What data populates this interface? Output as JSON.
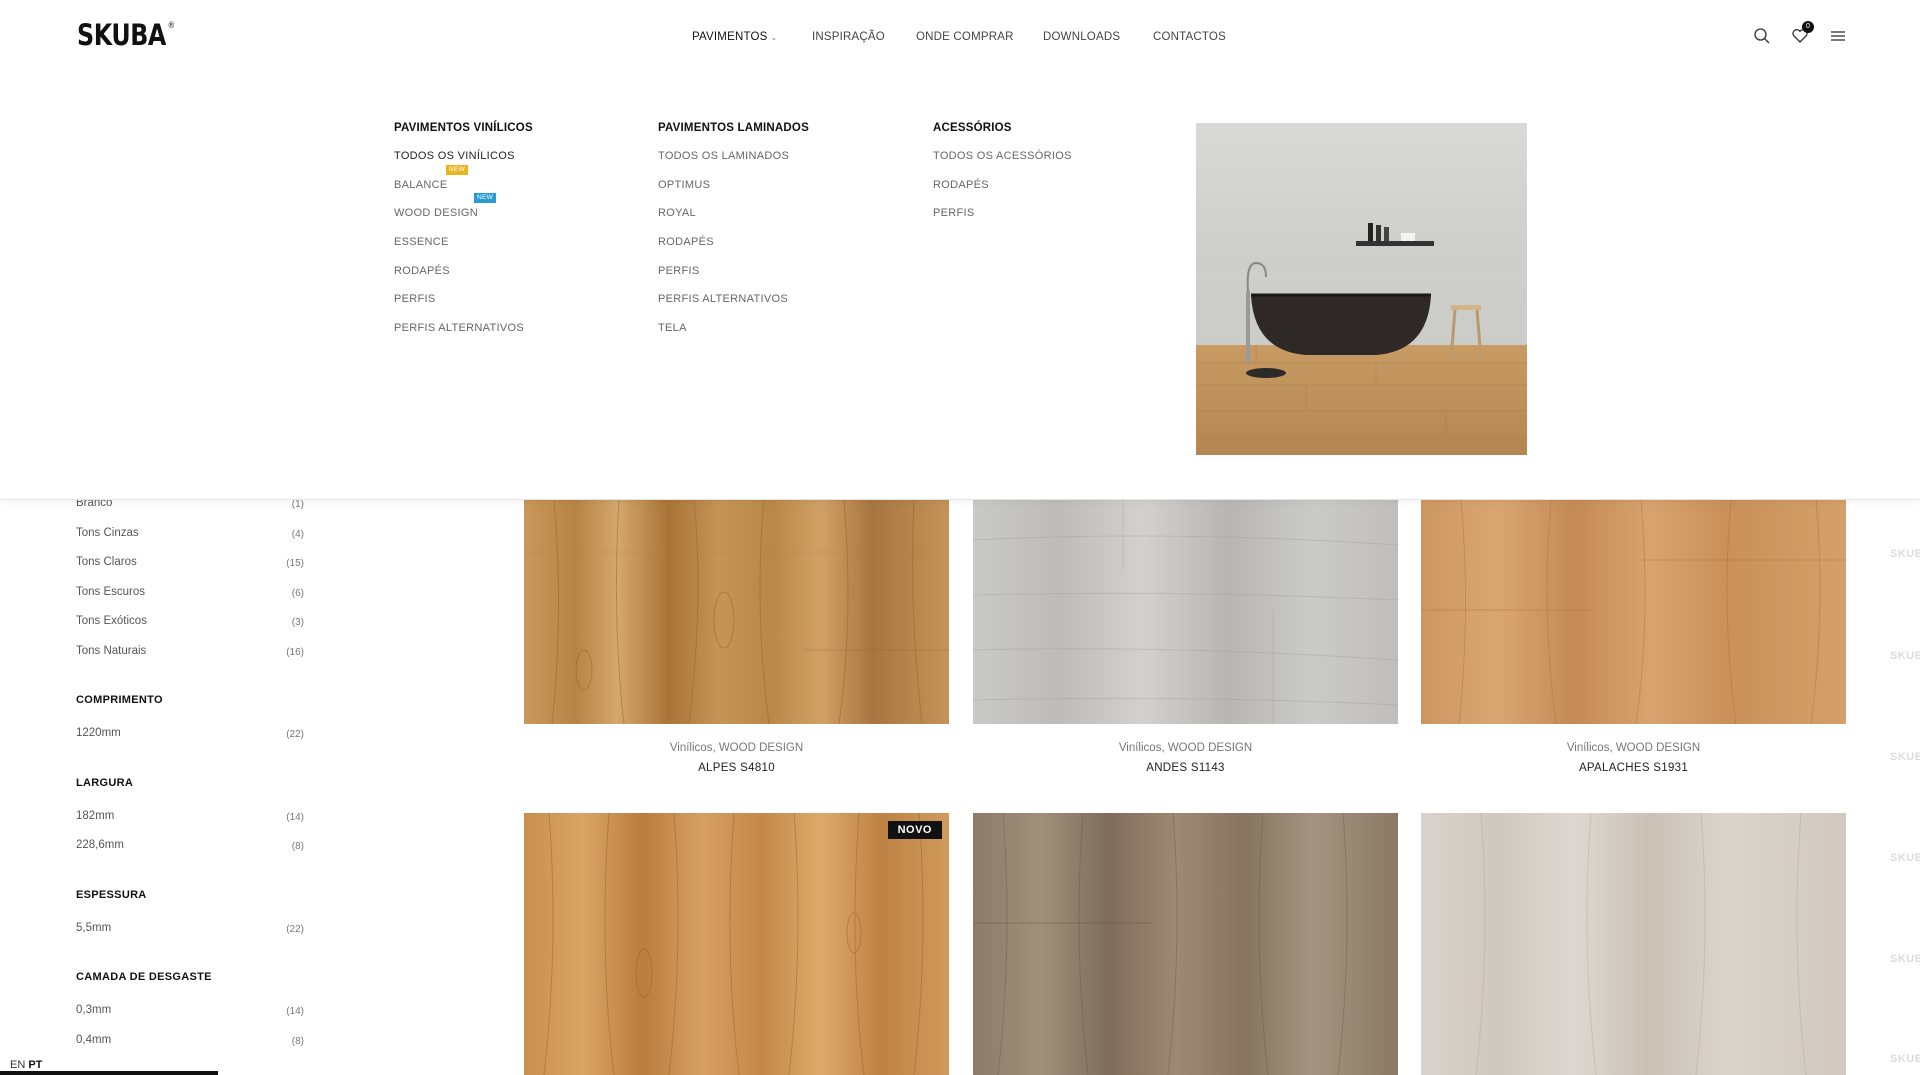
{
  "brand": {
    "logo": "SKUBA",
    "reg": "®"
  },
  "nav": {
    "items": [
      "PAVIMENTOS",
      "INSPIRAÇÃO",
      "ONDE COMPRAR",
      "DOWNLOADS",
      "CONTACTOS"
    ],
    "wishlist_count": "0"
  },
  "mega": {
    "col1": {
      "title": "PAVIMENTOS VINÍLICOS",
      "items": [
        "TODOS OS VINÍLICOS",
        "BALANCE",
        "WOOD DESIGN",
        "ESSENCE",
        "RODAPÉS",
        "PERFIS",
        "PERFIS ALTERNATIVOS"
      ],
      "tag_balance": "NEW",
      "tag_wood": "NEW"
    },
    "col2": {
      "title": "PAVIMENTOS LAMINADOS",
      "items": [
        "TODOS OS LAMINADOS",
        "OPTIMUS",
        "ROYAL",
        "RODAPÉS",
        "PERFIS",
        "PERFIS ALTERNATIVOS",
        "TELA"
      ]
    },
    "col3": {
      "title": "ACESSÓRIOS",
      "items": [
        "TODOS OS ACESSÓRIOS",
        "RODAPÉS",
        "PERFIS"
      ]
    }
  },
  "filters": {
    "cores": [
      {
        "label": "Branco",
        "count": "(1)"
      },
      {
        "label": "Tons Cinzas",
        "count": "(4)"
      },
      {
        "label": "Tons Claros",
        "count": "(15)"
      },
      {
        "label": "Tons Escuros",
        "count": "(6)"
      },
      {
        "label": "Tons Exóticos",
        "count": "(3)"
      },
      {
        "label": "Tons Naturais",
        "count": "(16)"
      }
    ],
    "comprimento": {
      "title": "COMPRIMENTO",
      "items": [
        {
          "label": "1220mm",
          "count": "(22)"
        }
      ]
    },
    "largura": {
      "title": "LARGURA",
      "items": [
        {
          "label": "182mm",
          "count": "(14)"
        },
        {
          "label": "228,6mm",
          "count": "(8)"
        }
      ]
    },
    "espessura": {
      "title": "ESPESSURA",
      "items": [
        {
          "label": "5,5mm",
          "count": "(22)"
        }
      ]
    },
    "camada": {
      "title": "CAMADA DE DESGASTE",
      "items": [
        {
          "label": "0,3mm",
          "count": "(14)"
        },
        {
          "label": "0,4mm",
          "count": "(8)"
        }
      ]
    }
  },
  "products": [
    {
      "category": "Vinílicos, WOOD DESIGN",
      "name": "ALPES S4810"
    },
    {
      "category": "Vinílicos, WOOD DESIGN",
      "name": "ANDES S1143"
    },
    {
      "category": "Vinílicos, WOOD DESIGN",
      "name": "APALACHES S1931"
    }
  ],
  "badge_novo": "NOVO",
  "watermark": "SKUBA",
  "lang": {
    "en": "EN",
    "pt": "PT"
  },
  "colors": {
    "accent_yellow": "#e8b422",
    "accent_blue": "#2a9bd1",
    "text_dark": "#111111"
  }
}
